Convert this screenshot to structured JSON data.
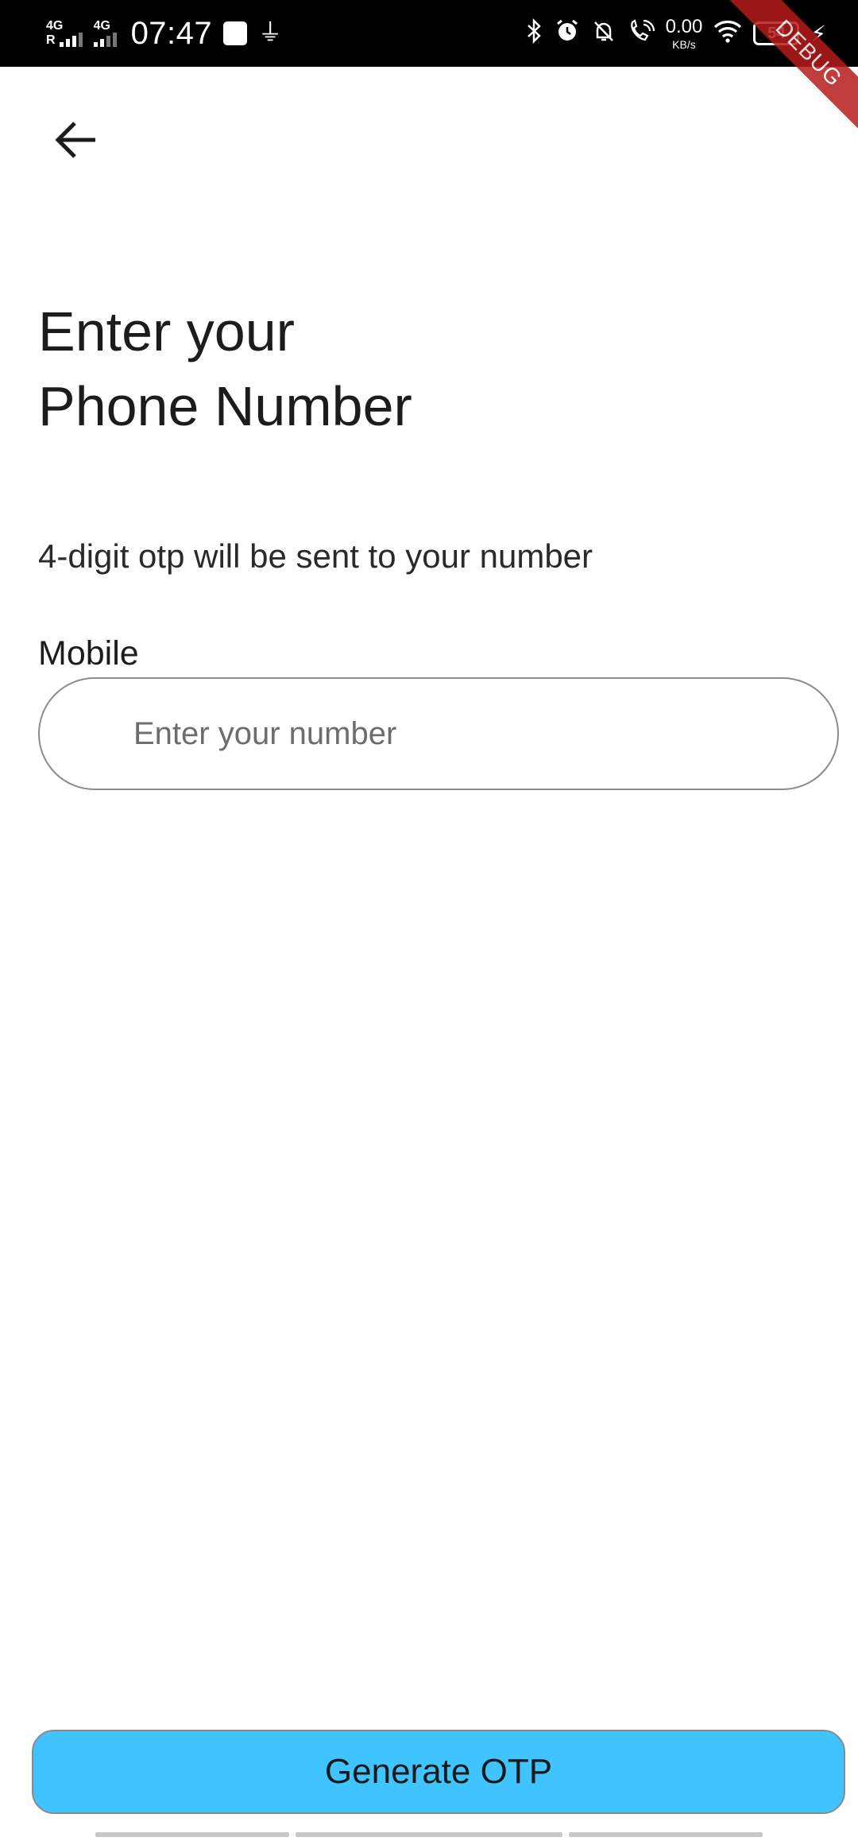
{
  "status_bar": {
    "net1_label": "4G",
    "net1_sub": "R",
    "net2_label": "4G",
    "time": "07:47",
    "speed_value": "0.00",
    "speed_unit": "KB/s",
    "battery": "54",
    "icons": [
      "usb-debug-icon",
      "usb-icon",
      "bluetooth-icon",
      "alarm-icon",
      "bell-off-icon",
      "wifi-calling-icon",
      "wifi-icon",
      "battery-icon",
      "charging-icon"
    ]
  },
  "debug_banner": "DEBUG",
  "header": {
    "back_icon": "arrow-left-icon"
  },
  "main": {
    "title_line1": "Enter your",
    "title_line2": "Phone Number",
    "subtitle": "4-digit otp will be sent to your number",
    "field_label": "Mobile",
    "input_placeholder": "Enter your number",
    "input_value": ""
  },
  "footer": {
    "button_label": "Generate OTP",
    "button_color": "#40c4ff"
  }
}
